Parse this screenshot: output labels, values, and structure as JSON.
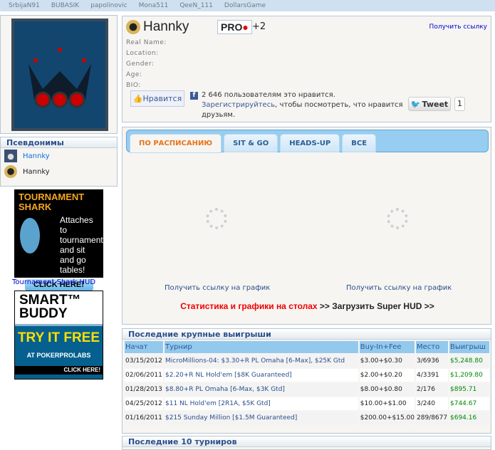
{
  "topbar": {
    "names": [
      "SrbijaN91",
      "BUBASIK",
      "papolinovic",
      "Mona511",
      "QeeN_111",
      "DollarsGame"
    ]
  },
  "pseudonyms": {
    "title": "Псевдонимы",
    "items": [
      {
        "name": "Hannky",
        "icon": "user-icon"
      },
      {
        "name": "Hannky",
        "icon": "spade-icon"
      }
    ]
  },
  "ads": {
    "shark": {
      "title": "TOURNAMENT SHARK",
      "text": "Attaches to tournament and sit and go tables!",
      "button": "CLICK HERE!",
      "label": "Tournament Shark HUD"
    },
    "buddy": {
      "title": "SMART™ BUDDY",
      "cta": "TRY IT FREE",
      "sub": "AT POKERPROLABS",
      "button": "CLICK HERE!"
    }
  },
  "profile": {
    "name": "Hannky",
    "badge": "PRO",
    "extra": "+2",
    "get_link": "Получить ссылку",
    "fields": [
      "Real Name:",
      "Location:",
      "Gender:",
      "Age:",
      "BIO:"
    ],
    "like_button": "Нравится",
    "fb_count": "2 646 пользователям это нравится.",
    "fb_register": "Зарегистрируйтесь",
    "fb_rest": ", чтобы посмотреть, что нравится друзьям.",
    "tweet": "Tweet",
    "tweet_count": "1"
  },
  "stats": {
    "tabs": [
      "ПО РАСПИСАНИЮ",
      "SIT & GO",
      "HEADS-UP",
      "ВСЕ"
    ],
    "active_tab": 0,
    "graph_link": "Получить ссылку на график",
    "hud_red": "Статистика и графики на столах",
    "hud_rest": " >> Загрузить Super HUD >>"
  },
  "wins": {
    "title": "Последние крупные выигрыши",
    "columns": [
      "Начат",
      "Турнир",
      "Buy-In+Fee",
      "Место",
      "Выигрыш"
    ],
    "rows": [
      [
        "03/15/2012",
        "MicroMillions-04: $3.30+R PL Omaha [6-Max], $25K Gtd",
        "$3.00+$0.30",
        "3/6936",
        "$5,248.80"
      ],
      [
        "02/06/2011",
        "$2.20+R NL Hold'em [$8K Guaranteed]",
        "$2.00+$0.20",
        "4/3391",
        "$1,209.80"
      ],
      [
        "01/28/2013",
        "$8.80+R PL Omaha [6-Max, $3K Gtd]",
        "$8.00+$0.80",
        "2/176",
        "$895.71"
      ],
      [
        "04/25/2012",
        "$11 NL Hold'em [2R1A, $5K Gtd]",
        "$10.00+$1.00",
        "3/240",
        "$744.67"
      ],
      [
        "01/16/2011",
        "$215 Sunday Million [$1.5M Guaranteed]",
        "$200.00+$15.00",
        "289/8677",
        "$694.16"
      ]
    ]
  },
  "last10": {
    "title": "Последние 10 турниров"
  }
}
